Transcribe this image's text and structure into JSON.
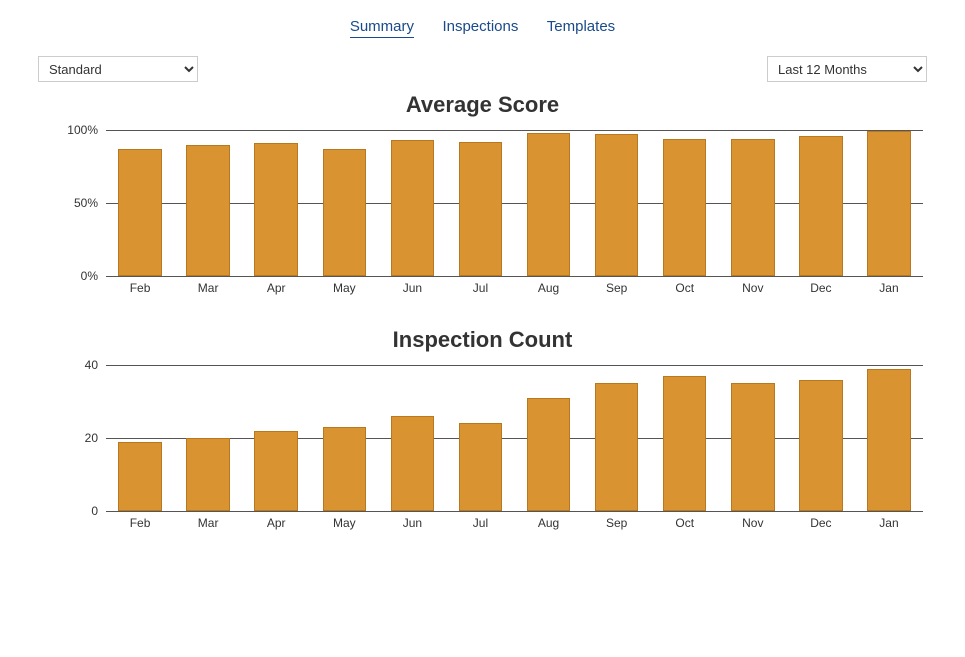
{
  "tabs": {
    "summary": "Summary",
    "inspections": "Inspections",
    "templates": "Templates",
    "active": "summary"
  },
  "controls": {
    "type_select_value": "Standard",
    "range_select_value": "Last 12 Months"
  },
  "colors": {
    "bar_fill": "#d99431",
    "bar_stroke": "#b87820",
    "link": "#1a4a8a"
  },
  "chart_data": [
    {
      "type": "bar",
      "title": "Average Score",
      "categories": [
        "Feb",
        "Mar",
        "Apr",
        "May",
        "Jun",
        "Jul",
        "Aug",
        "Sep",
        "Oct",
        "Nov",
        "Dec",
        "Jan"
      ],
      "values": [
        87,
        90,
        91,
        87,
        93,
        92,
        98,
        97,
        94,
        94,
        96,
        99
      ],
      "ylim": [
        0,
        100
      ],
      "yticks": [
        0,
        50,
        100
      ],
      "yformat": "percent",
      "xlabel": "",
      "ylabel": ""
    },
    {
      "type": "bar",
      "title": "Inspection Count",
      "categories": [
        "Feb",
        "Mar",
        "Apr",
        "May",
        "Jun",
        "Jul",
        "Aug",
        "Sep",
        "Oct",
        "Nov",
        "Dec",
        "Jan"
      ],
      "values": [
        19,
        20,
        22,
        23,
        26,
        24,
        31,
        35,
        37,
        35,
        36,
        39
      ],
      "ylim": [
        0,
        40
      ],
      "yticks": [
        0,
        20,
        40
      ],
      "yformat": "number",
      "xlabel": "",
      "ylabel": ""
    }
  ]
}
